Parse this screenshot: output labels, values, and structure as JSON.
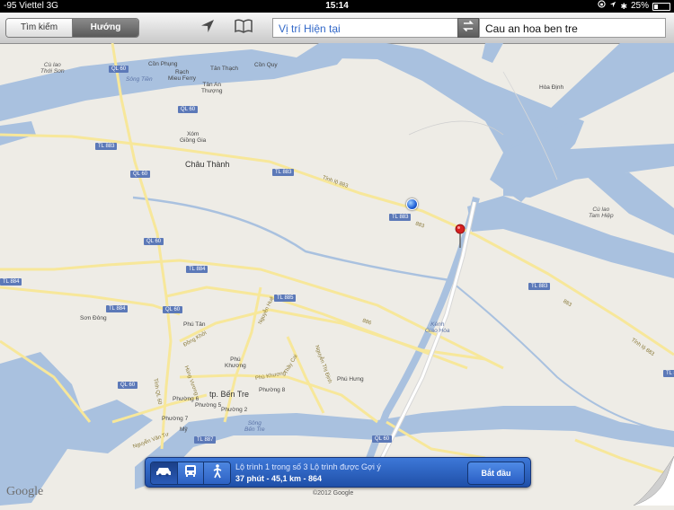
{
  "status_bar": {
    "carrier": "-95 Viettel  3G",
    "time": "15:14",
    "battery_percent": "25%",
    "battery_level": 0.25
  },
  "toolbar": {
    "search_tab_label": "Tìm kiếm",
    "directions_tab_label": "Hướng",
    "start_field_value": "Vị trí Hiện tại",
    "end_field_value": "Cau an hoa ben tre"
  },
  "map": {
    "places": {
      "cu_lao_thoi_son_1": "Cù lao",
      "cu_lao_thoi_son_2": "Thới Sơn",
      "con_phung": "Cồn Phụng",
      "rach_mieu_ferry_1": "Rạch",
      "rach_mieu_ferry_2": "Mieu Ferry",
      "song_tien": "Sông Tiền",
      "tan_thach": "Tân Thạch",
      "con_quy": "Cồn Quy",
      "tan_an_thuong_1": "Tân An",
      "tan_an_thuong_2": "Thượng",
      "hoa_dinh": "Hòa Định",
      "xom_giong_gia_1": "Xóm",
      "xom_giong_gia_2": "Giồng Gia",
      "chau_thanh": "Châu Thành",
      "cu_lao_tam_hiep_1": "Cù lao",
      "cu_lao_tam_hiep_2": "Tam Hiệp",
      "son_dong": "Sơn Đông",
      "phu_tan": "Phú Tân",
      "kenh_giao_hoa_1": "Kênh",
      "kenh_giao_hoa_2": "Giao Hòa",
      "phu_khuong_1": "Phú",
      "phu_khuong_2": "Khương",
      "phu_hung": "Phú Hưng",
      "tp_ben_tre": "tp. Bến Tre",
      "phuong_8": "Phường 8",
      "phuong_6": "Phường 6",
      "phuong_5": "Phường 5",
      "phuong_2": "Phường 2",
      "phuong_7": "Phường 7",
      "song_ben_tre_1": "Sông",
      "song_ben_tre_2": "Bến Tre",
      "my": "Mỹ"
    },
    "road_shields": {
      "ql60_a": "QL 60",
      "ql60_b": "QL 60",
      "ql60_c": "QL 60",
      "ql60_d": "QL 60",
      "ql60_e": "QL 60",
      "ql60_f": "QL 60",
      "ql60_g": "QL 60",
      "tl883_a": "TL 883",
      "tl883_b": "TL 883",
      "tl883_c": "TL 883",
      "tl883_d": "TL 883",
      "tl883_e": "TL 883",
      "tl884_a": "TL 884",
      "tl884_b": "TL 884",
      "tl884_c": "TL 884",
      "tl885": "TL 885",
      "tl887": "TL 887"
    },
    "road_names": {
      "tinh_lo_883_a": "Tỉnh lộ 883",
      "tinh_lo_883_b": "Tỉnh lộ 883",
      "n883_a": "883",
      "n883_b": "883",
      "dong_khoi": "Đồng Khởi",
      "nguyen_hue": "Nguyễn Huệ",
      "phu_khuong_rd": "Phú Khương",
      "thay_cai": "Thầy Cai",
      "nguyen_thi_dinh": "Nguyễn Thị Định",
      "n886": "886",
      "nguyen_van_tu": "Nguyễn Văn Tư",
      "hung_vuong": "Hùng Vương",
      "tinh_lo_60": "Tỉnh QL 60"
    }
  },
  "route_bar": {
    "modes": [
      "car-icon",
      "bus-icon",
      "walk-icon"
    ],
    "selected_mode": "car",
    "route_title": "Lộ trình 1 trong số 3 Lộ trình được Gợi ý",
    "route_summary": "37 phút - 45,1 km - 864",
    "start_button_label": "Bắt đầu"
  },
  "footer": {
    "google_logo": "Google",
    "copyright": "©2012 Google"
  }
}
